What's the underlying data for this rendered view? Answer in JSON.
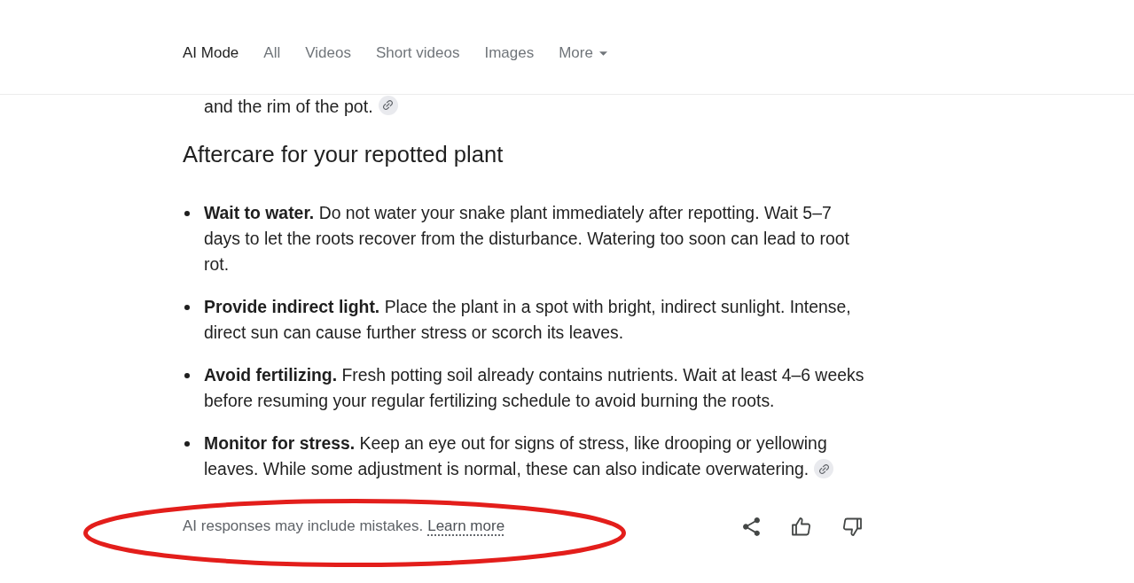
{
  "tabs": [
    {
      "label": "AI Mode",
      "selected": true,
      "kind": "tab"
    },
    {
      "label": "All",
      "selected": false,
      "kind": "tab"
    },
    {
      "label": "Videos",
      "selected": false,
      "kind": "tab"
    },
    {
      "label": "Short videos",
      "selected": false,
      "kind": "tab"
    },
    {
      "label": "Images",
      "selected": false,
      "kind": "tab"
    },
    {
      "label": "More",
      "selected": false,
      "kind": "menu"
    }
  ],
  "answer": {
    "partial_line": {
      "text": "and the rim of the pot.",
      "source_link": true
    },
    "heading": "Aftercare for your repotted plant",
    "bullets": [
      {
        "text": "**Wait to water.** Do not water your snake plant immediately after repotting. Wait 5–7 days to let the roots recover from the disturbance. Watering too soon can lead to root rot.",
        "source_link": false
      },
      {
        "text": "**Provide indirect light.** Place the plant in a spot with bright, indirect sunlight. Intense, direct sun can cause further stress or scorch its leaves.",
        "source_link": false
      },
      {
        "text": "**Avoid fertilizing.** Fresh potting soil already contains nutrients. Wait at least 4–6 weeks before resuming your regular fertilizing schedule to avoid burning the roots.",
        "source_link": false
      },
      {
        "text": "**Monitor for stress.** Keep an eye out for signs of stress, like drooping or yellowing leaves. While some adjustment is normal, these can also indicate overwatering.",
        "source_link": true
      }
    ]
  },
  "footer": {
    "disclaimer": "AI responses may include mistakes.",
    "link": "Learn more"
  },
  "annotations": [
    {
      "kind": "ellipse"
    }
  ]
}
